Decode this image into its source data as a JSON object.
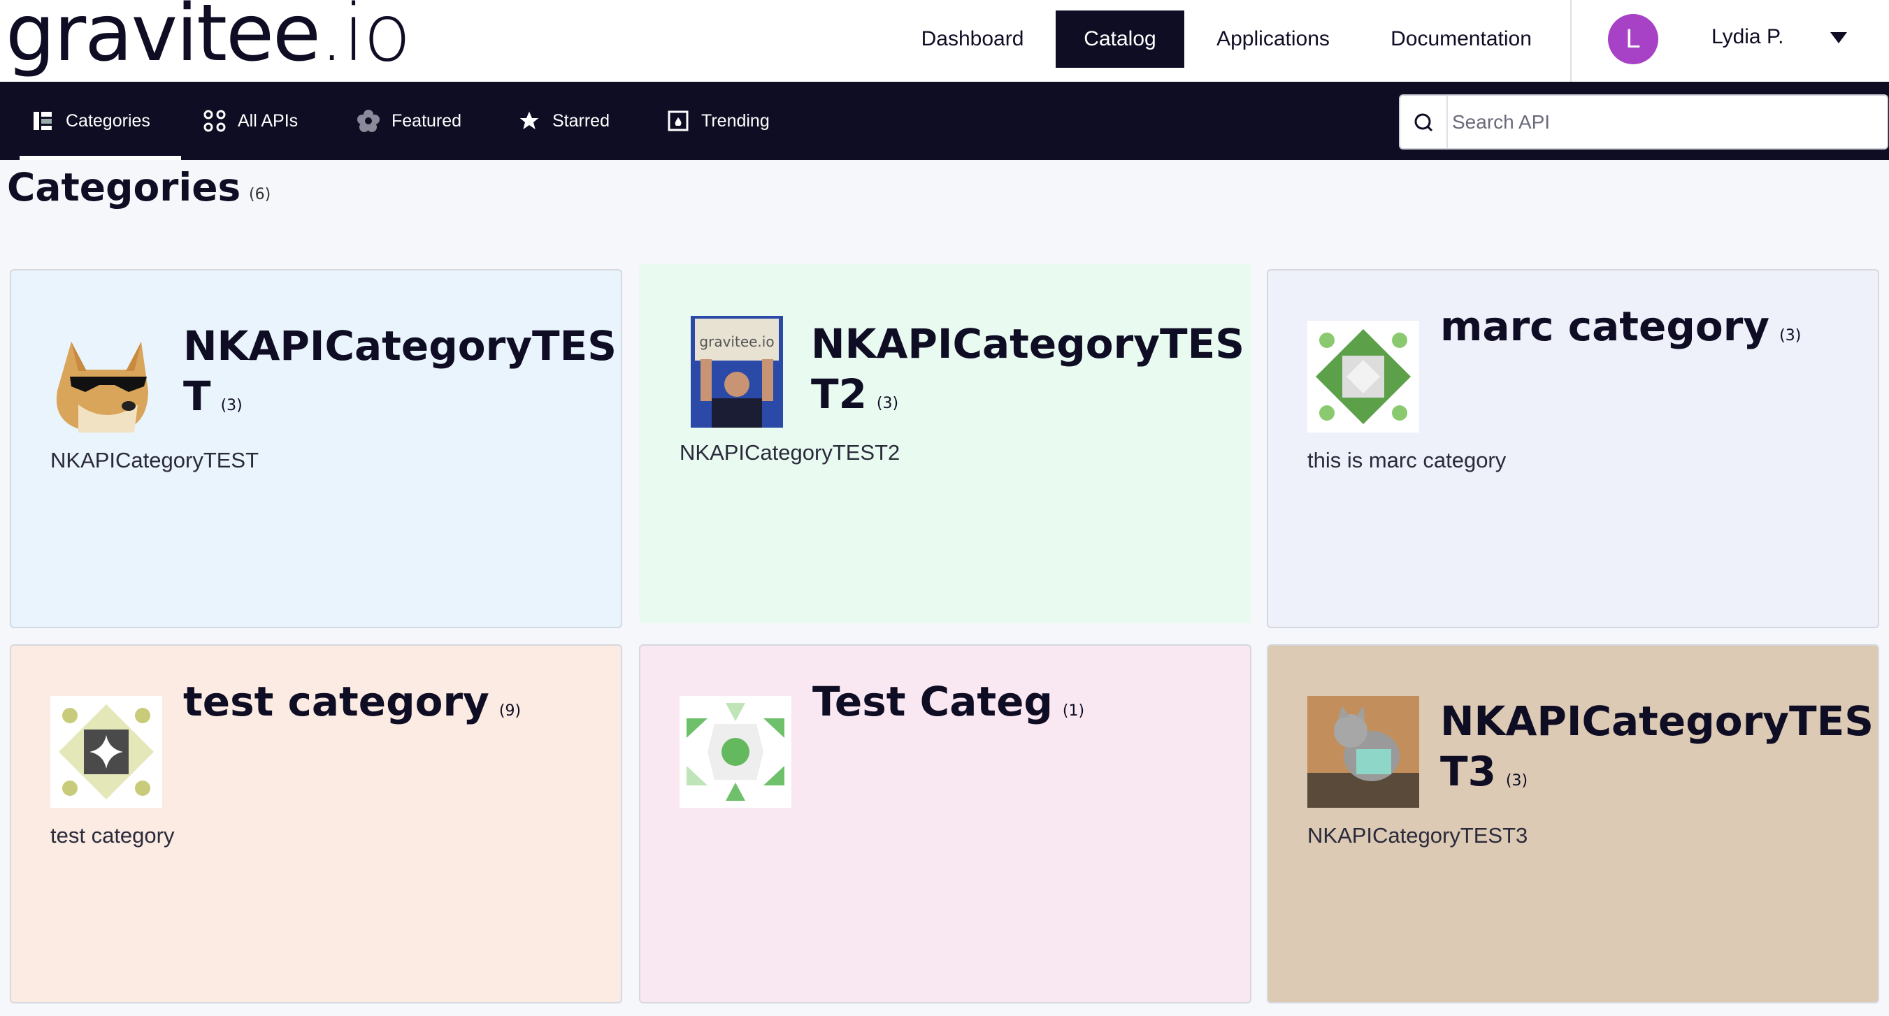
{
  "brand": {
    "logo_main": "gravitee",
    "logo_suffix": ".io"
  },
  "topnav": {
    "dashboard": "Dashboard",
    "catalog": "Catalog",
    "applications": "Applications",
    "documentation": "Documentation"
  },
  "user": {
    "initial": "L",
    "name": "Lydia P."
  },
  "subnav": {
    "categories": "Categories",
    "all_apis": "All APIs",
    "featured": "Featured",
    "starred": "Starred",
    "trending": "Trending"
  },
  "search": {
    "placeholder": "Search API"
  },
  "page": {
    "title": "Categories",
    "count": "(6)"
  },
  "cards": [
    {
      "title": "NKAPICategoryTES T",
      "count": "(3)",
      "description": "NKAPICategoryTEST",
      "bg": "#eaf4fc",
      "thumb": "doge-sunglasses"
    },
    {
      "title": "NKAPICategoryTES T2",
      "count": "(3)",
      "description": "NKAPICategoryTEST2",
      "bg": "#e9fbf1",
      "thumb": "person-holding-gravitee-sign"
    },
    {
      "title": "marc category",
      "count": "(3)",
      "description": "this is marc category",
      "bg": "#eef0fa",
      "thumb": "green-identicon"
    },
    {
      "title": "test category",
      "count": "(9)",
      "description": "test category",
      "bg": "#fbebe3",
      "thumb": "olive-identicon"
    },
    {
      "title": "Test Categ",
      "count": "(1)",
      "description": "",
      "bg": "#f9e7f1",
      "thumb": "green-circle-identicon"
    },
    {
      "title": "NKAPICategoryTES T3",
      "count": "(3)",
      "description": "NKAPICategoryTEST3",
      "bg": "#dccab5",
      "thumb": "cat-photo"
    }
  ]
}
